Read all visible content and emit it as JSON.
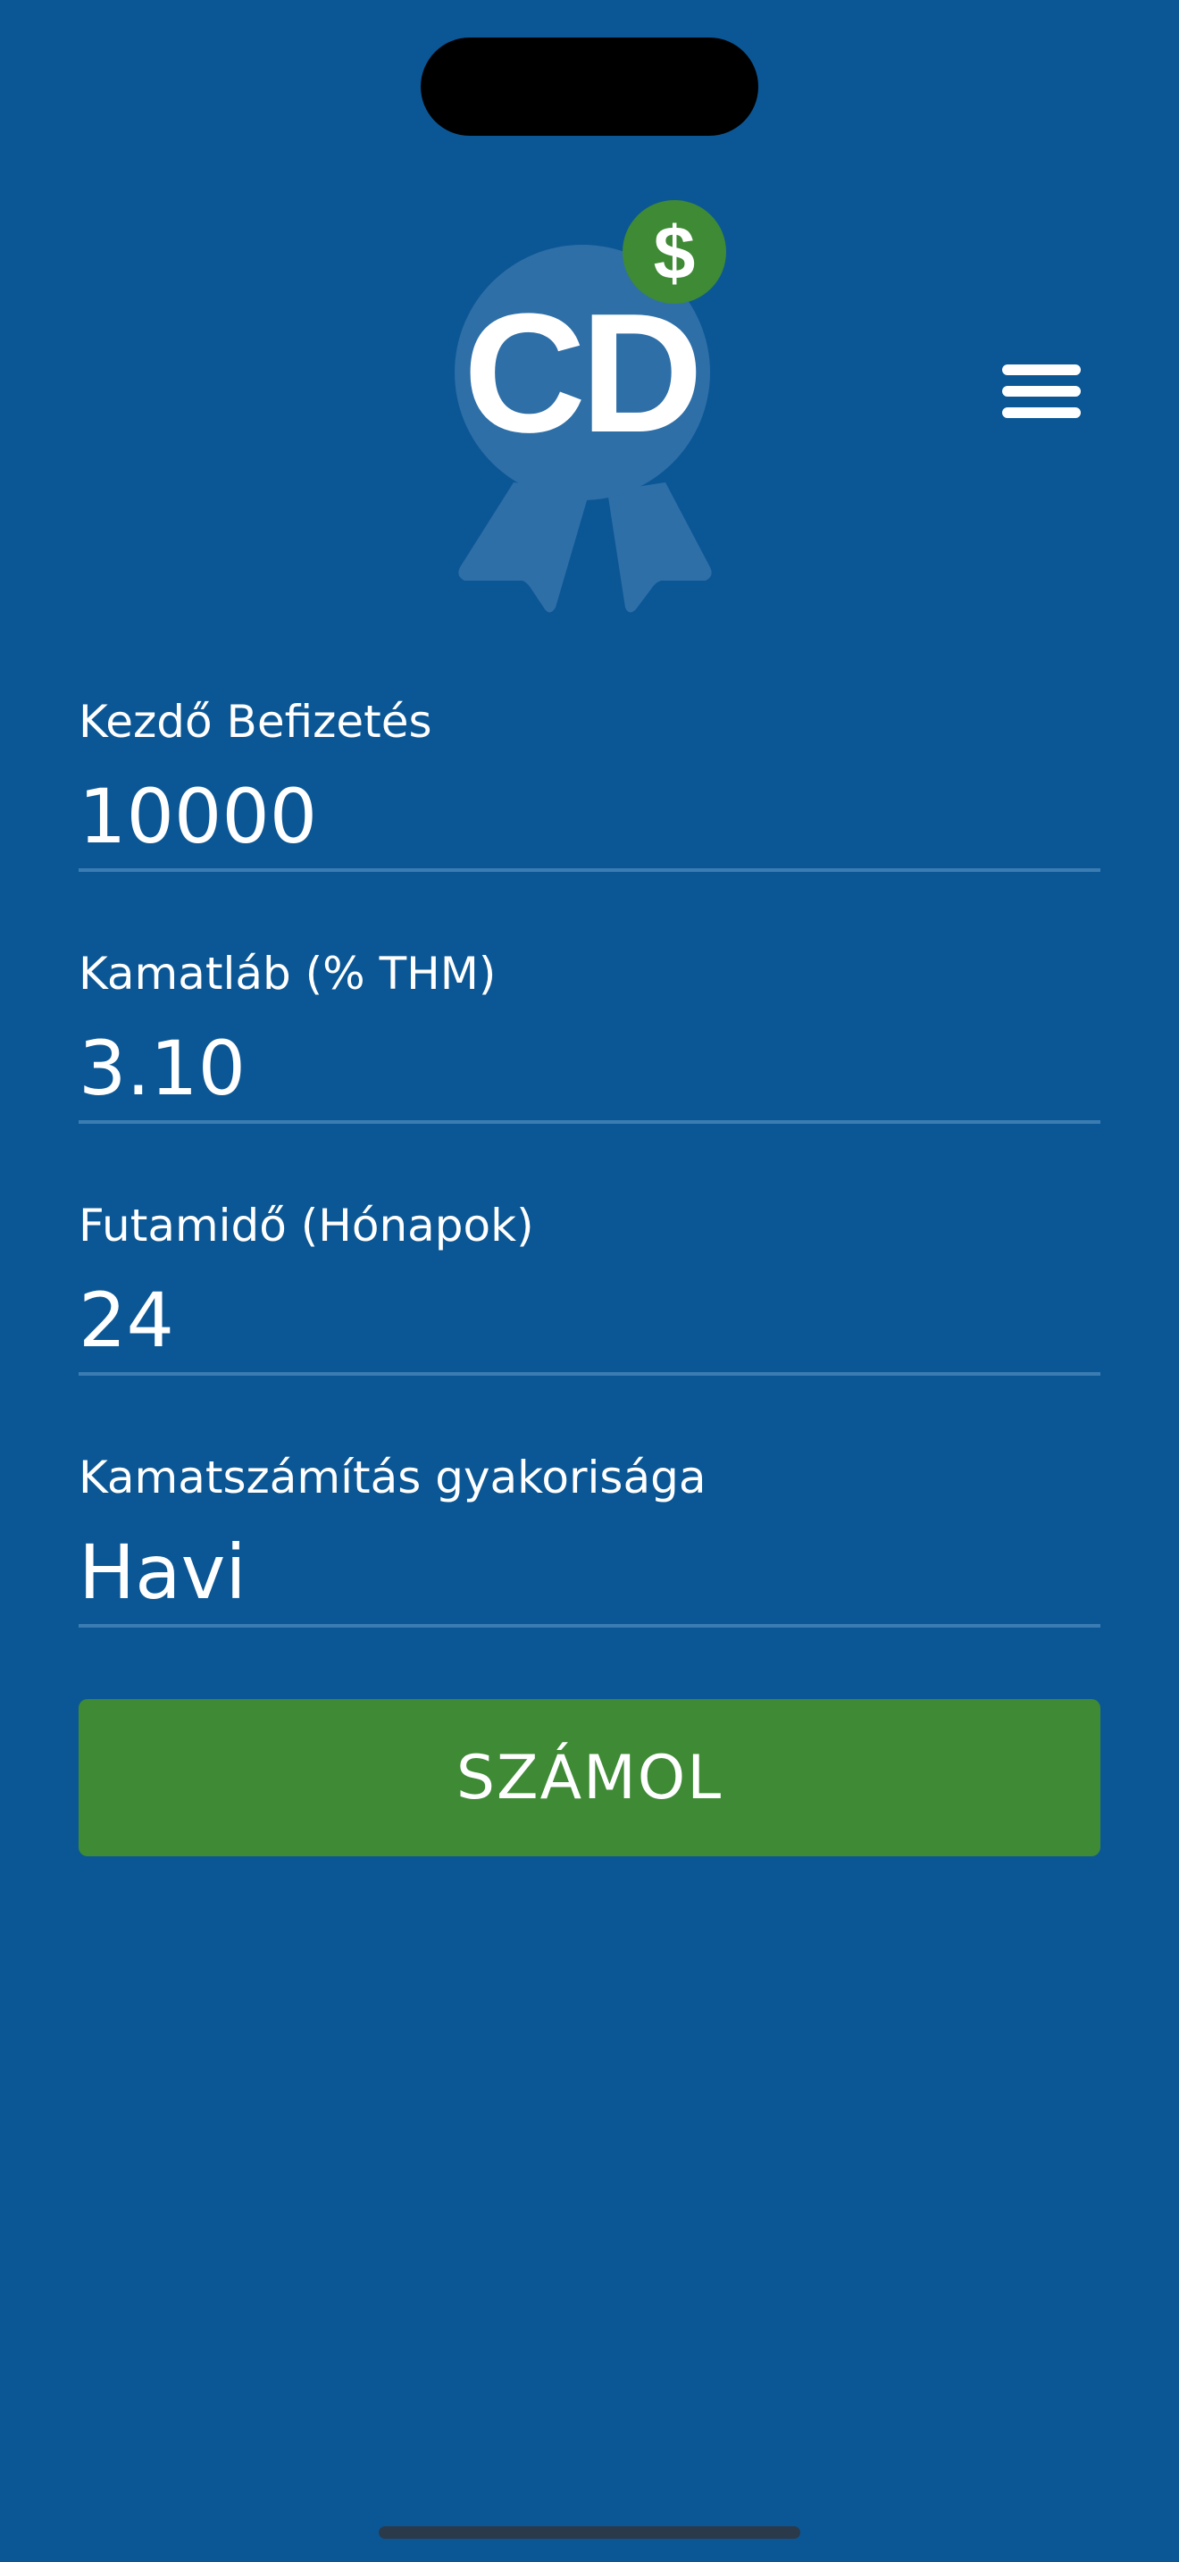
{
  "colors": {
    "background": "#0b5795",
    "button": "#3e8a35",
    "badge": "#3e8a35",
    "logo_circle": "#2e6fa8",
    "divider": "#3b7db3"
  },
  "header": {
    "logo_text": "CD",
    "logo_badge_symbol": "$",
    "menu_icon": "hamburger-menu-icon"
  },
  "form": {
    "fields": [
      {
        "label": "Kezdő Befizetés",
        "value": "10000"
      },
      {
        "label": "Kamatláb (% THM)",
        "value": "3.10"
      },
      {
        "label": "Futamidő (Hónapok)",
        "value": "24"
      },
      {
        "label": "Kamatszámítás gyakorisága",
        "value": "Havi"
      }
    ],
    "calculate_label": "SZÁMOL"
  }
}
